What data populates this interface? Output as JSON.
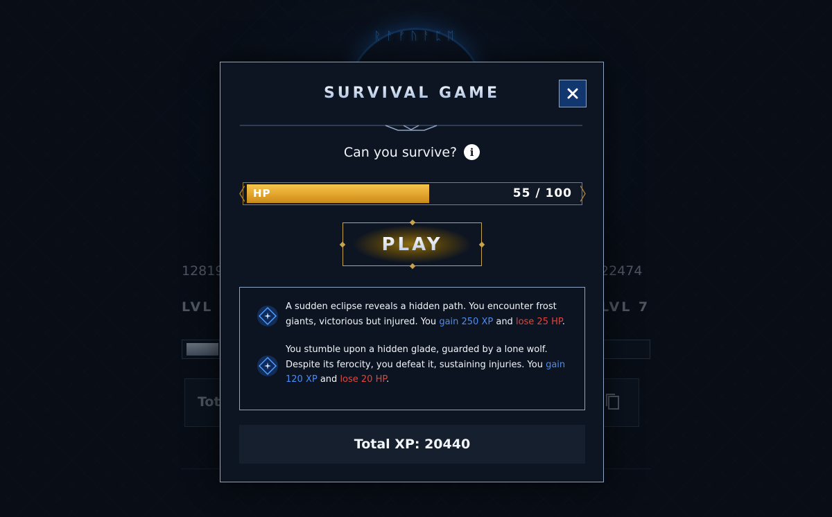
{
  "background": {
    "left_number": "12819",
    "right_number": "22474",
    "left_level": "LVL 6",
    "right_level": "LVL 7",
    "card_text": "Tota",
    "runes": "ᚱᚨᚠᚢᚨᛈᛖ"
  },
  "modal": {
    "title": "SURVIVAL GAME",
    "subtitle": "Can you survive?",
    "hp": {
      "label": "HP",
      "current": 55,
      "max": 100,
      "value_text": "55 / 100"
    },
    "play_label": "PLAY",
    "events": [
      {
        "text_before": "A sudden eclipse reveals a hidden path. You encounter frost giants, victorious but injured. You ",
        "gain": "gain 250 XP",
        "middle": " and ",
        "lose": "lose 25 HP",
        "text_after": "."
      },
      {
        "text_before": "You stumble upon a hidden glade, guarded by a lone wolf. Despite its ferocity, you defeat it, sustaining injuries. You ",
        "gain": "gain 120 XP",
        "middle": " and ",
        "lose": "lose 20 HP",
        "text_after": "."
      }
    ],
    "total_xp": "Total XP: 20440"
  },
  "colors": {
    "accent_gold": "#e0a12a",
    "gain_blue": "#4a8cf5",
    "lose_red": "#e0463c",
    "close_blue": "#12366e"
  },
  "icons": {
    "close": "close-icon",
    "info": "info-icon",
    "event": "diamond-compass-icon",
    "copy": "copy-icon"
  }
}
